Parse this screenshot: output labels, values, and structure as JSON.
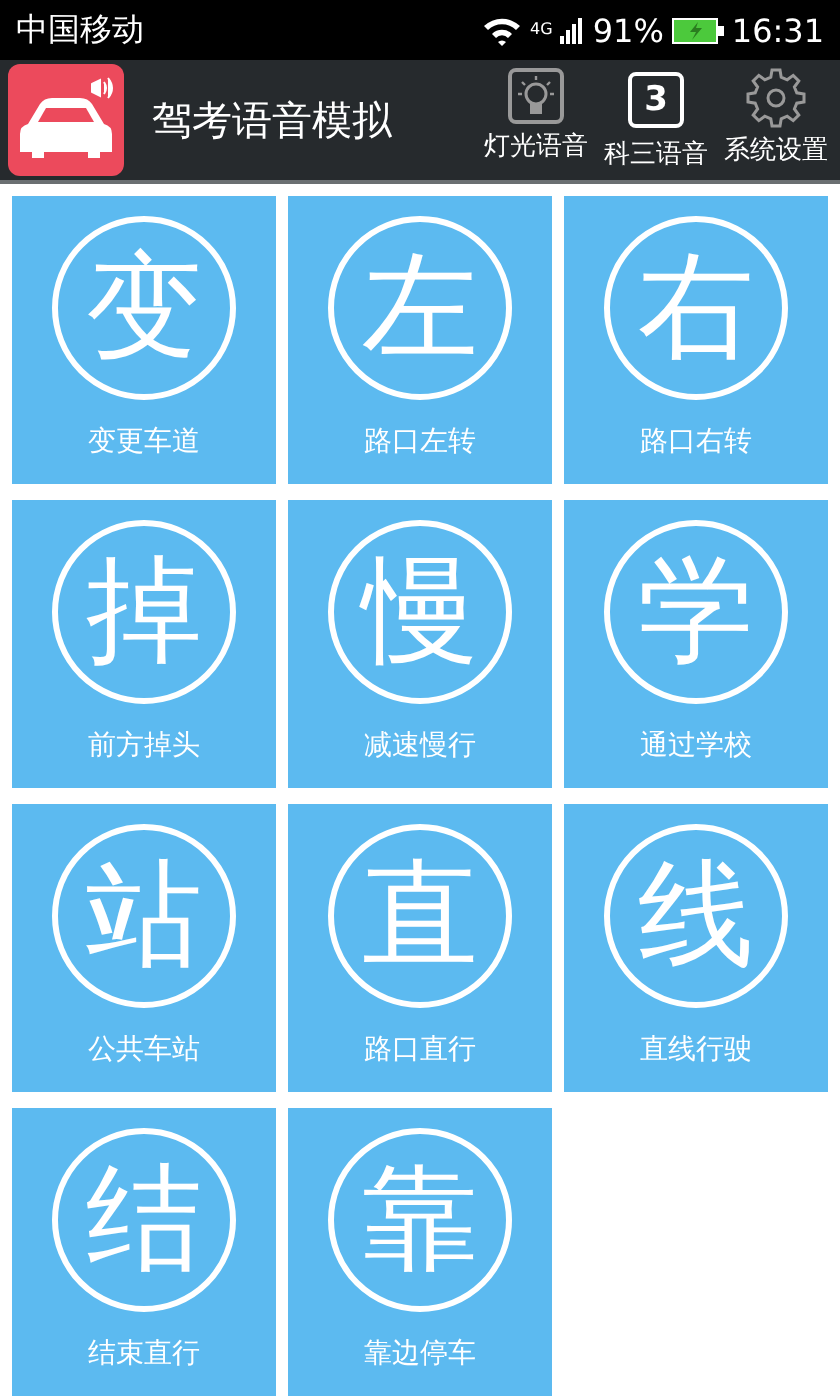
{
  "status_bar": {
    "carrier": "中国移动",
    "network": "4G",
    "battery": "91%",
    "time": "16:31"
  },
  "header": {
    "title": "驾考语音模拟",
    "actions": [
      {
        "kind": "bulb",
        "label": "灯光语音"
      },
      {
        "kind": "digit",
        "digit": "3",
        "label": "科三语音"
      },
      {
        "kind": "gear",
        "label": "系统设置"
      }
    ]
  },
  "tiles": [
    {
      "char": "变",
      "label": "变更车道"
    },
    {
      "char": "左",
      "label": "路口左转"
    },
    {
      "char": "右",
      "label": "路口右转"
    },
    {
      "char": "掉",
      "label": "前方掉头"
    },
    {
      "char": "慢",
      "label": "减速慢行"
    },
    {
      "char": "学",
      "label": "通过学校"
    },
    {
      "char": "站",
      "label": "公共车站"
    },
    {
      "char": "直",
      "label": "路口直行"
    },
    {
      "char": "线",
      "label": "直线行驶"
    },
    {
      "char": "结",
      "label": "结束直行"
    },
    {
      "char": "靠",
      "label": "靠边停车"
    }
  ]
}
